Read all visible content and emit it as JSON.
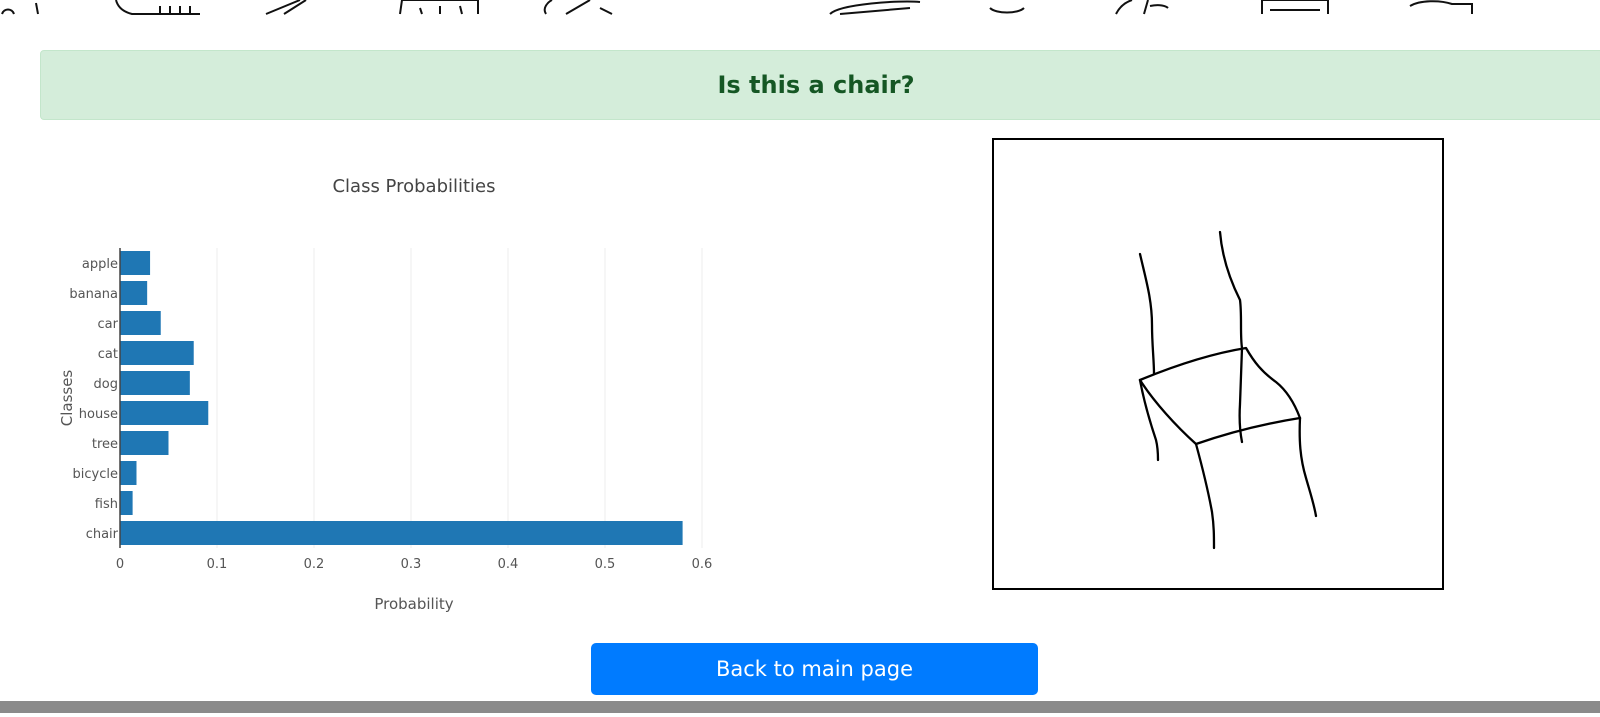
{
  "banner": {
    "text": "Is this a chair?",
    "background_color": "#d4edda",
    "text_color": "#155724"
  },
  "chart_data": {
    "type": "bar",
    "orientation": "horizontal",
    "title": "Class Probabilities",
    "xlabel": "Probability",
    "ylabel": "Classes",
    "categories": [
      "apple",
      "banana",
      "car",
      "cat",
      "dog",
      "house",
      "tree",
      "bicycle",
      "fish",
      "chair"
    ],
    "values": [
      0.031,
      0.028,
      0.042,
      0.076,
      0.072,
      0.091,
      0.05,
      0.017,
      0.013,
      0.58
    ],
    "xlim": [
      0,
      0.6
    ],
    "xticks": [
      "0",
      "0.1",
      "0.2",
      "0.3",
      "0.4",
      "0.5",
      "0.6"
    ],
    "grid": true,
    "bar_color": "#1f77b4"
  },
  "drawing": {
    "subject": "chair sketch"
  },
  "actions": {
    "back_label": "Back to main page",
    "button_color": "#007bff"
  }
}
